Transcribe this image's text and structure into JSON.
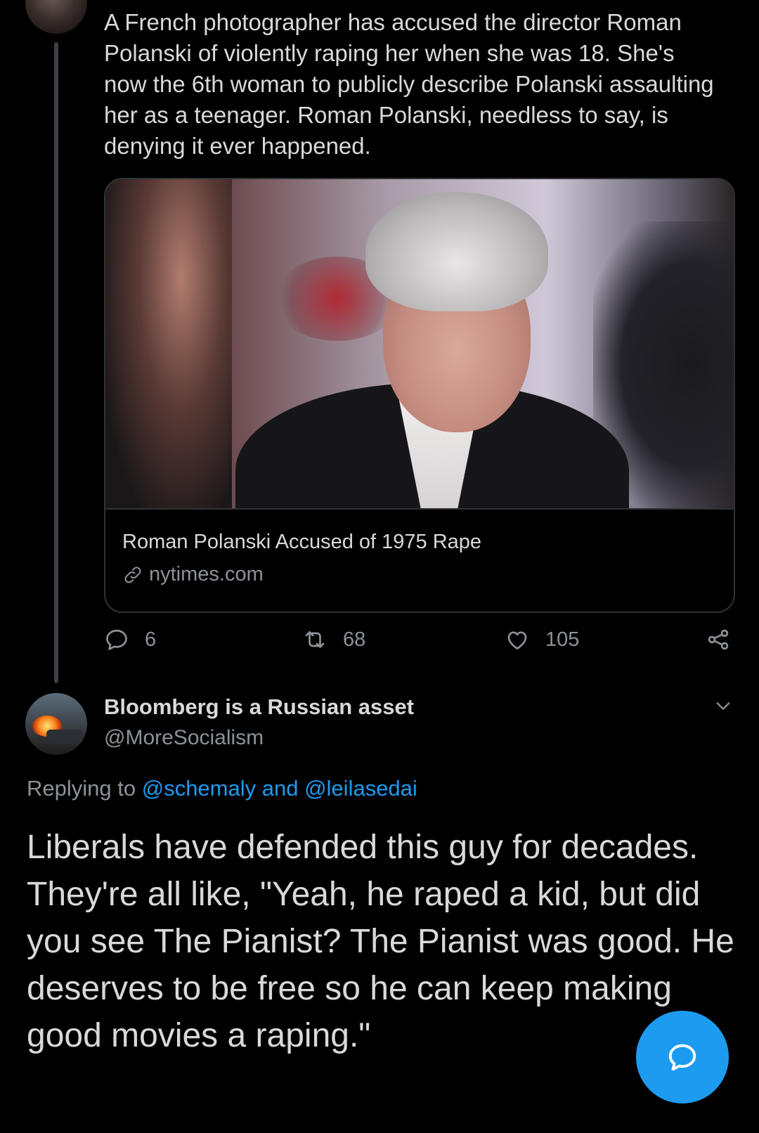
{
  "parent_tweet": {
    "text": "A French photographer has accused the director Roman Polanski of violently raping her when she was 18. She's now the 6th woman to publicly describe  Polanski assaulting her as a teenager. Roman Polanski, needless to say, is denying it ever happened.",
    "card": {
      "title": "Roman Polanski Accused of 1975 Rape",
      "domain": "nytimes.com"
    },
    "actions": {
      "replies": "6",
      "retweets": "68",
      "likes": "105"
    }
  },
  "reply_tweet": {
    "display_name": "Bloomberg is a Russian asset",
    "handle": "@MoreSocialism",
    "replying_prefix": "Replying to ",
    "mention_1": "@schemaly",
    "mention_joiner": " and ",
    "mention_2": "@leilasedai",
    "text": "Liberals have defended this guy for decades. They're all like, \"Yeah, he raped a kid, but did you see The Pianist? The Pianist was good. He deserves to be free so he can keep making good movies a raping.\""
  },
  "icons": {
    "reply": "reply-icon",
    "retweet": "retweet-icon",
    "like": "heart-icon",
    "share": "share-icon",
    "link": "link-icon",
    "chevron": "chevron-down-icon",
    "compose": "compose-reply-icon"
  },
  "colors": {
    "background": "#000000",
    "text": "#d9d9d9",
    "muted": "#8b9298",
    "accent": "#1d9bf0",
    "border": "#2f3336"
  }
}
